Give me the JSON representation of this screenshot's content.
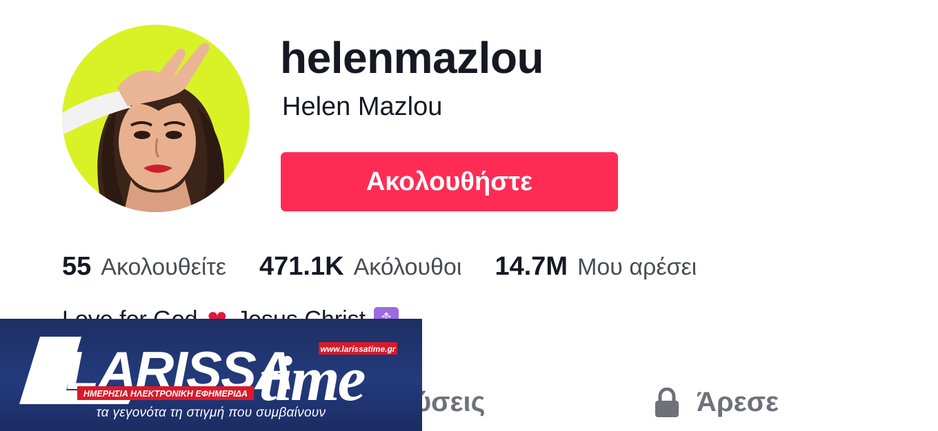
{
  "profile": {
    "username": "helenmazlou",
    "display_name": "Helen Mazlou",
    "follow_label": "Ακολουθήστε",
    "avatar_icon": "profile-photo"
  },
  "stats": [
    {
      "value": "55",
      "label": "Ακολουθείτε"
    },
    {
      "value": "471.1K",
      "label": "Ακόλουθοι"
    },
    {
      "value": "14.7M",
      "label": "Μου αρέσει"
    }
  ],
  "bio": {
    "text_1": "Love for God",
    "text_2": "Jesus Christ",
    "heart_icon": "❤",
    "cross_icon": "☦"
  },
  "tabs": [
    {
      "label": "Δημοσιεύσεις",
      "visible_label": "οσιεύσεις"
    },
    {
      "label": "Άρεσε",
      "icon": "lock-icon"
    }
  ],
  "watermark": {
    "logo_word_1": "LARISSA",
    "logo_word_2": "time",
    "url": "www.larissatime.gr",
    "subtitle": "ΗΜΕΡΗΣΙΑ ΗΛΕΚΤΡΟΝΙΚΗ ΕΦΗΜΕΡΙΔΑ",
    "tagline": "τα γεγονότα τη στιγμή που συμβαίνουν",
    "colors": {
      "navy": "#1e2f63",
      "red": "#d91a2a",
      "white": "#ffffff"
    }
  },
  "colors": {
    "accent": "#fe2c55",
    "text_primary": "#161823",
    "text_secondary": "#4a4b54",
    "tab_text": "#6f7079"
  }
}
